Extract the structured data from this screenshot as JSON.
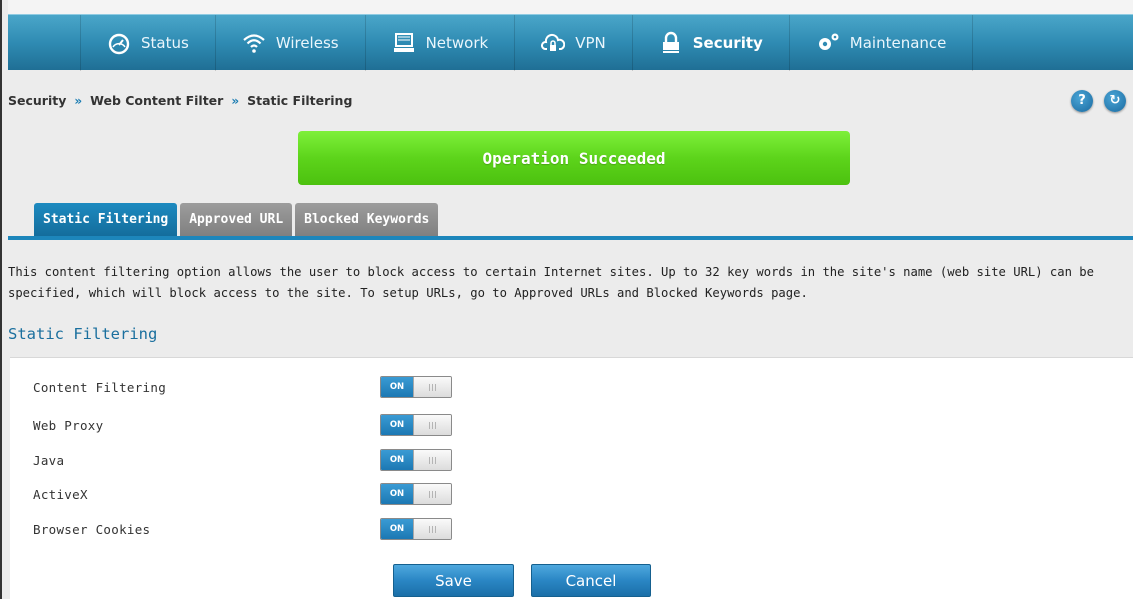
{
  "nav": {
    "items": [
      {
        "label": "Status",
        "icon": "gauge-icon",
        "active": false
      },
      {
        "label": "Wireless",
        "icon": "wifi-icon",
        "active": false
      },
      {
        "label": "Network",
        "icon": "monitor-icon",
        "active": false
      },
      {
        "label": "VPN",
        "icon": "cloud-lock-icon",
        "active": false
      },
      {
        "label": "Security",
        "icon": "lock-icon",
        "active": true
      },
      {
        "label": "Maintenance",
        "icon": "gears-icon",
        "active": false
      }
    ]
  },
  "breadcrumb": {
    "items": [
      "Security",
      "Web Content Filter",
      "Static Filtering"
    ],
    "separator": "»"
  },
  "header_buttons": {
    "help": "?",
    "refresh": "↻"
  },
  "banner": {
    "text": "Operation Succeeded",
    "color": "#5dd41b"
  },
  "tabs": [
    {
      "label": "Static Filtering",
      "active": true
    },
    {
      "label": "Approved URL",
      "active": false
    },
    {
      "label": "Blocked Keywords",
      "active": false
    }
  ],
  "description": "This content filtering option allows the user to block access to certain Internet sites. Up to 32 key words in the site's name (web site URL) can be specified, which will block access to the site. To setup URLs, go to Approved URLs and Blocked Keywords page.",
  "section_title": "Static Filtering",
  "settings": [
    {
      "label": "Content Filtering",
      "state": "ON"
    },
    {
      "label": "Web Proxy",
      "state": "ON"
    },
    {
      "label": "Java",
      "state": "ON"
    },
    {
      "label": "ActiveX",
      "state": "ON"
    },
    {
      "label": "Browser Cookies",
      "state": "ON"
    }
  ],
  "buttons": {
    "save": "Save",
    "cancel": "Cancel"
  },
  "colors": {
    "accent": "#1d86bb",
    "nav": "#2f8bb3"
  }
}
